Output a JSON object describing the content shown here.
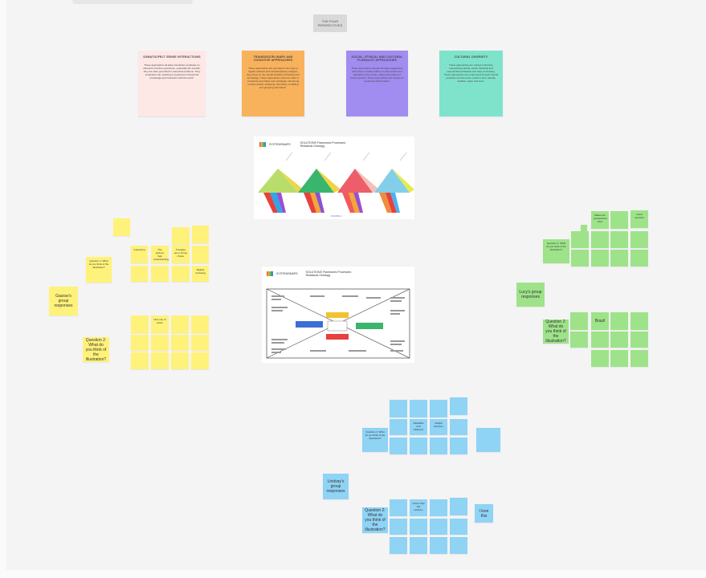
{
  "board": {
    "title": "THE FOUR PERSPECTIVES",
    "perspectives": [
      {
        "title": "SOMATIC/FELT SENSE INTERACTIONS",
        "body": "These approaches all place interaction emphasis on elements of active experience, especially the somatic; they are often grounded in real-world problems. They emphasize the meaning of experience through felt knowledge and interaction with the world.",
        "color": "#fde8e6"
      },
      {
        "title": "TRANSDISCIPLINARY AND COGNITIVE APPROACHES",
        "body": "These approaches are grounded in the rigor of logical, abstract and transdisciplinary analysis; they focus on the mental activities of thinking and knowledge. These approaches strive for order in complexity and clarity over ambiguity, structuring mental models, analyzing, theorizing, modelling and grouping information.",
        "color": "#f9b25c"
      },
      {
        "title": "SOCIAL, ETHICAL AND CULTURAL PLURALIST APPROACHES",
        "body": "These approaches interact through engagement with others; working within a social context and attending to the needs, values and culture of those involved. These approaches view design as social and ethical action.",
        "color": "#a18cf0"
      },
      {
        "title": "CULTURAL DIVERSITY",
        "body": "These approaches are rooted in diversity, recognizing cultural, social, historical and experiential worldviews and ways of knowing. These approaches are understood through cultural practices and are local, rooted in time, identity, tradition, place and more.",
        "color": "#7fe3cb"
      }
    ],
    "infographics": [
      {
        "logo": "SYSTEMSMAPS",
        "subtitle": "SOLUTIONS Framework Processes: Relational Ontology",
        "caption": "FIGURE 1"
      },
      {
        "logo": "SYSTEMSMAPS",
        "subtitle": "SOLUTIONS Framework Processes: Relational Ontology"
      }
    ],
    "groups": {
      "yellow": {
        "label": "Gaurav's group responses",
        "question1": "Question 1: What do you think of the illustration?",
        "question2": "Question 2: What do you think of the illustration?"
      },
      "green": {
        "label": "Lucy's group responses",
        "question1": "Question 1: What do you think of the illustration?",
        "question2": "Question 2: What do you think of the illustration?",
        "note": "Brazil"
      },
      "blue": {
        "label": "Lindsay's group responses",
        "question1": "Question 1: What do you think of the illustration?",
        "question2": "Question 2: What do you think of the illustration?",
        "note": "I love this"
      }
    },
    "notes": {
      "yellow_a": "Interesting",
      "yellow_b": "The pictures help understanding",
      "yellow_c": "Triangles are a strong choice",
      "yellow_d": "Slightly confusing",
      "yellow_e": "Nice use of colour",
      "green_a": "Makes the perspectives clear",
      "green_b": "Good overview",
      "blue_a": "Readable and balanced",
      "blue_b": "Helpful structure",
      "blue_c": "Colors help link sections"
    }
  }
}
